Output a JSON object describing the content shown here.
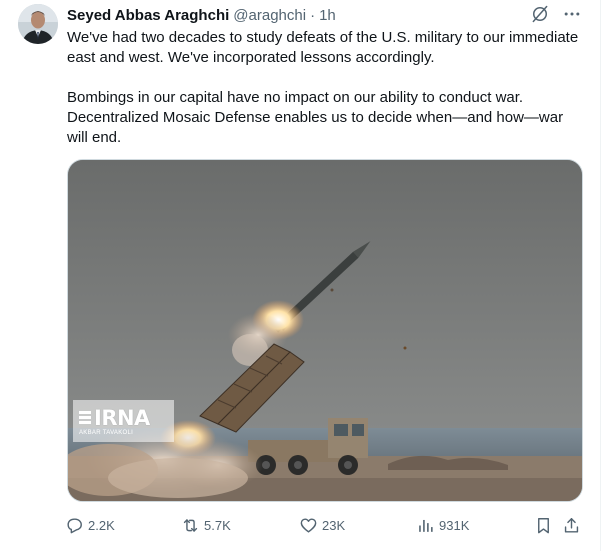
{
  "tweet": {
    "author": {
      "display_name": "Seyed Abbas Araghchi",
      "handle": "@araghchi",
      "separator": "·",
      "time": "1h",
      "avatar_icon": "profile-photo"
    },
    "paragraphs": [
      "We've had two decades to study defeats of the U.S. military to our immediate east and west. We've incorporated lessons accordingly.",
      "Bombings in our capital have no impact on our ability to conduct war. Decentralized Mosaic Defense enables us to decide when—and how—war will end."
    ],
    "media": {
      "watermark_logo": "IRNA",
      "watermark_credit": "AKBAR TAVAKOLI",
      "sky_color": "#6e706f",
      "ground_color": "#8a7a6a"
    },
    "top_icons": [
      "grok-icon",
      "more-icon"
    ],
    "stats": {
      "replies": "2.2K",
      "reposts": "5.7K",
      "likes": "23K",
      "views": "931K"
    },
    "action_icons": [
      "reply-icon",
      "repost-icon",
      "like-icon",
      "views-icon",
      "bookmark-icon",
      "share-icon"
    ]
  },
  "colors": {
    "text_primary": "#0f1419",
    "text_secondary": "#536471",
    "border": "#cfd9de"
  }
}
